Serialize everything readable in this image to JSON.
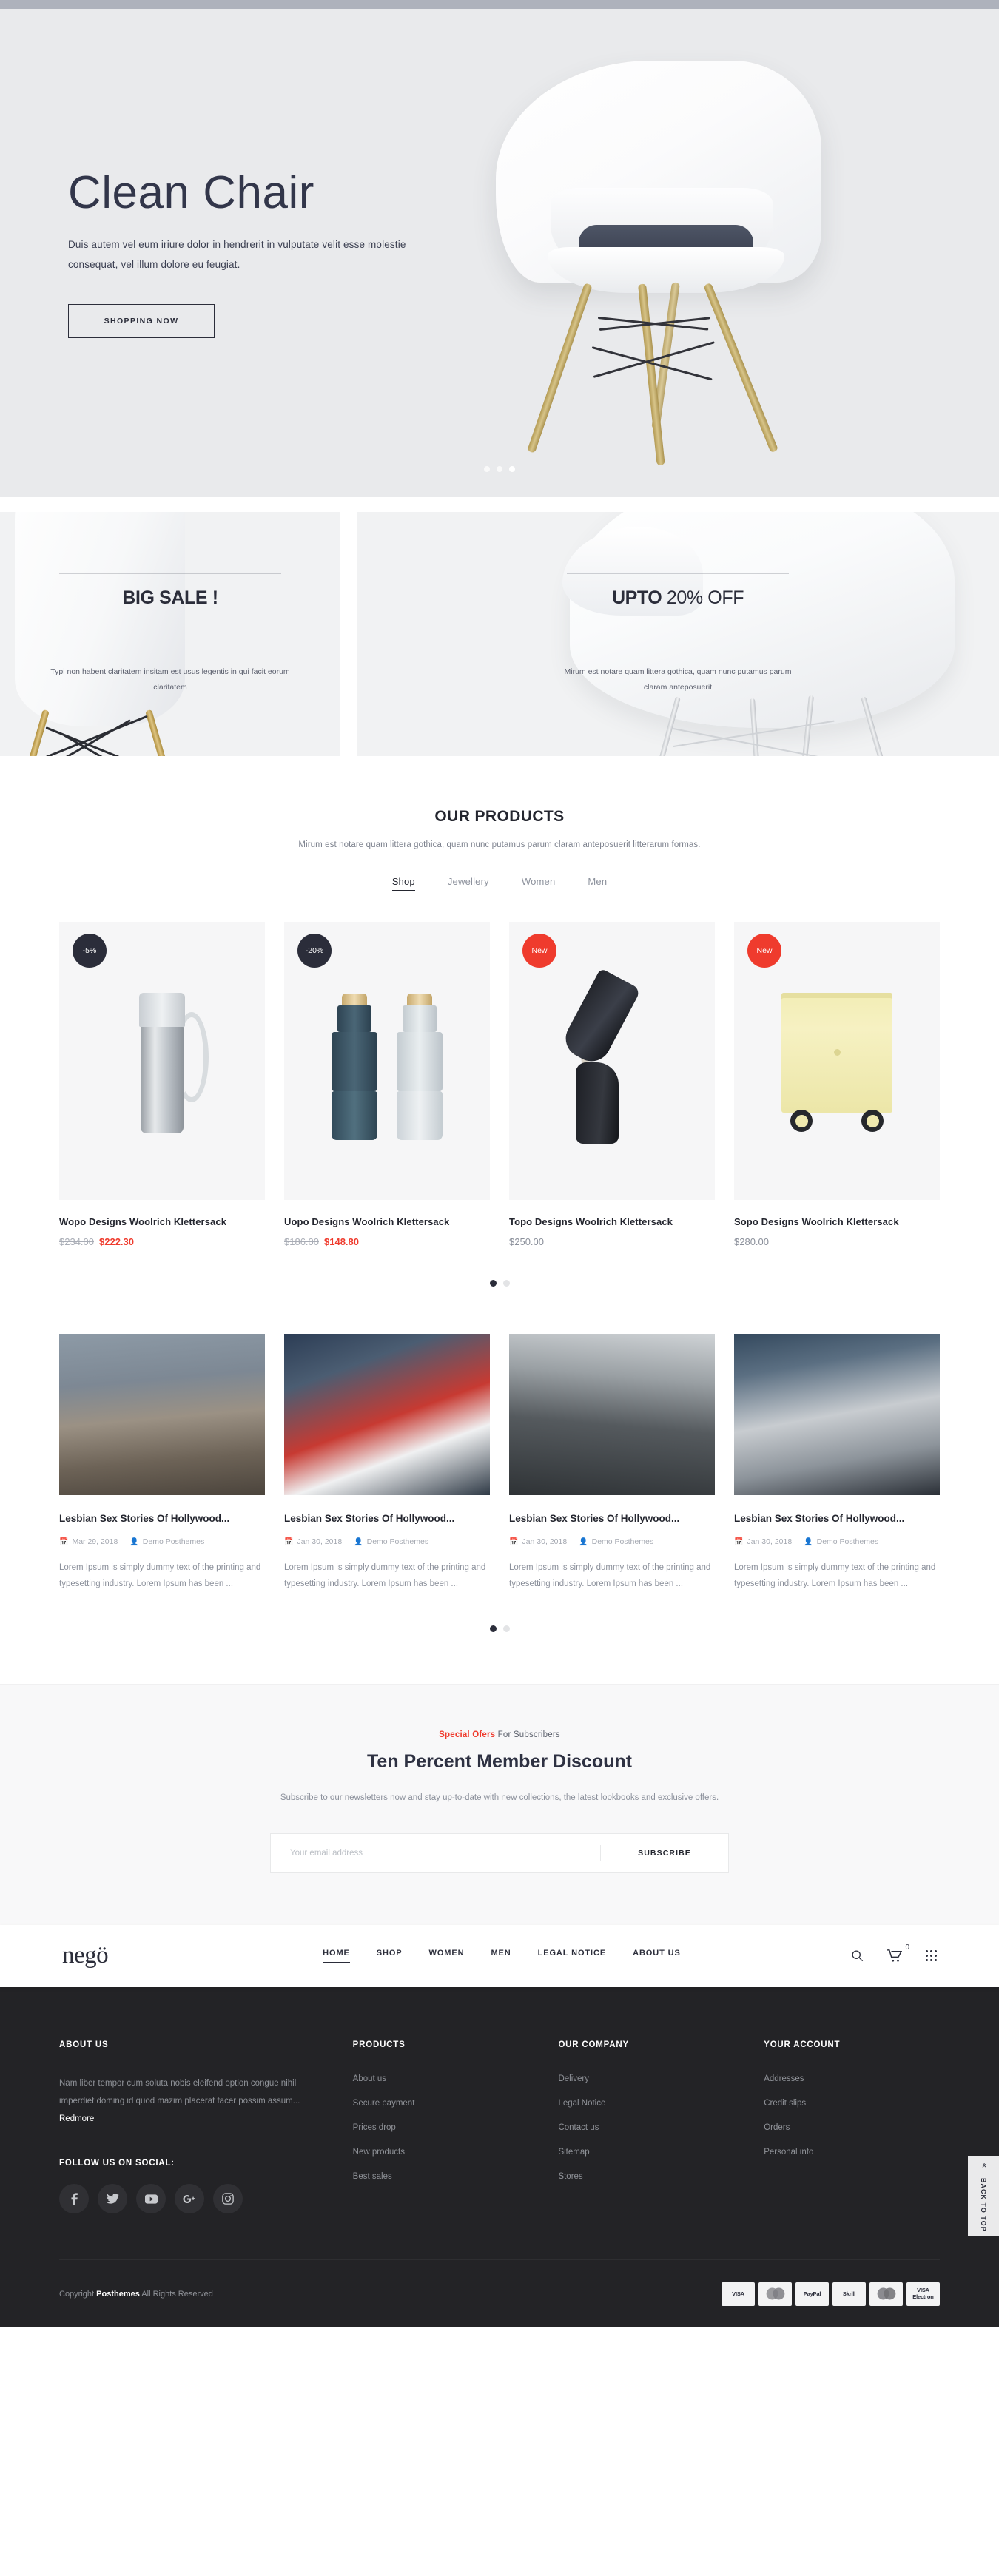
{
  "hero": {
    "title": "Clean Chair",
    "subtitle": "Duis autem vel eum iriure dolor in hendrerit in vulputate velit esse molestie consequat, vel illum dolore eu feugiat.",
    "button": "SHOPPING NOW",
    "slide_count": 3,
    "active_slide": 3
  },
  "promos": [
    {
      "title": "BIG SALE !",
      "desc": "Typi non habent claritatem insitam est usus legentis in qui facit eorum claritatem"
    },
    {
      "title_bold": "UPTO",
      "title_light": "20% OFF",
      "desc": "Mirum est notare quam littera gothica, quam nunc putamus parum claram anteposuerit"
    }
  ],
  "products_section": {
    "title": "OUR PRODUCTS",
    "subtitle": "Mirum est notare quam littera gothica, quam nunc putamus parum claram anteposuerit litterarum formas.",
    "tabs": [
      {
        "label": "Shop",
        "active": true
      },
      {
        "label": "Jewellery",
        "active": false
      },
      {
        "label": "Women",
        "active": false
      },
      {
        "label": "Men",
        "active": false
      }
    ],
    "items": [
      {
        "badge": "-5%",
        "badge_type": "sale",
        "name": "Wopo Designs Woolrich Klettersack",
        "old_price": "$234.00",
        "price": "$222.30",
        "on_sale": true
      },
      {
        "badge": "-20%",
        "badge_type": "sale",
        "name": "Uopo Designs Woolrich Klettersack",
        "old_price": "$186.00",
        "price": "$148.80",
        "on_sale": true
      },
      {
        "badge": "New",
        "badge_type": "new",
        "name": "Topo Designs Woolrich Klettersack",
        "old_price": "",
        "price": "$250.00",
        "on_sale": false
      },
      {
        "badge": "New",
        "badge_type": "new",
        "name": "Sopo Designs Woolrich Klettersack",
        "old_price": "",
        "price": "$280.00",
        "on_sale": false
      }
    ],
    "dots": 2,
    "active_dot": 1
  },
  "blog": {
    "posts": [
      {
        "title": "Lesbian Sex Stories Of Hollywood...",
        "date": "Mar 29, 2018",
        "author": "Demo Posthemes",
        "excerpt": "Lorem Ipsum is simply dummy text of the printing and typesetting industry. Lorem Ipsum has been ..."
      },
      {
        "title": "Lesbian Sex Stories Of Hollywood...",
        "date": "Jan 30, 2018",
        "author": "Demo Posthemes",
        "excerpt": "Lorem Ipsum is simply dummy text of the printing and typesetting industry. Lorem Ipsum has been ..."
      },
      {
        "title": "Lesbian Sex Stories Of Hollywood...",
        "date": "Jan 30, 2018",
        "author": "Demo Posthemes",
        "excerpt": "Lorem Ipsum is simply dummy text of the printing and typesetting industry. Lorem Ipsum has been ..."
      },
      {
        "title": "Lesbian Sex Stories Of Hollywood...",
        "date": "Jan 30, 2018",
        "author": "Demo Posthemes",
        "excerpt": "Lorem Ipsum is simply dummy text of the printing and typesetting industry. Lorem Ipsum has been ..."
      }
    ],
    "dots": 2,
    "active_dot": 1
  },
  "newsletter": {
    "kicker_highlight": "Special Ofers",
    "kicker_rest": " For Subscribers",
    "title": "Ten Percent Member Discount",
    "desc": "Subscribe to our newsletters now and stay up-to-date with new collections, the latest lookbooks and exclusive offers.",
    "placeholder": "Your email address",
    "button": "SUBSCRIBE",
    "value": ""
  },
  "navbar": {
    "logo": "negö",
    "menu": [
      {
        "label": "HOME",
        "active": true
      },
      {
        "label": "SHOP",
        "active": false
      },
      {
        "label": "WOMEN",
        "active": false
      },
      {
        "label": "MEN",
        "active": false
      },
      {
        "label": "LEGAL NOTICE",
        "active": false
      },
      {
        "label": "ABOUT US",
        "active": false
      }
    ],
    "cart_count": "0"
  },
  "footer": {
    "about": {
      "heading": "ABOUT US",
      "text": "Nam liber tempor cum soluta nobis eleifend option congue nihil imperdiet doming id quod mazim placerat facer possim assum...",
      "more": "Redmore",
      "social_heading": "FOLLOW US ON SOCIAL:",
      "socials": [
        "facebook-icon",
        "twitter-icon",
        "youtube-icon",
        "google-plus-icon",
        "instagram-icon"
      ]
    },
    "columns": [
      {
        "heading": "PRODUCTS",
        "links": [
          "About us",
          "Secure payment",
          "Prices drop",
          "New products",
          "Best sales"
        ]
      },
      {
        "heading": "OUR COMPANY",
        "links": [
          "Delivery",
          "Legal Notice",
          "Contact us",
          "Sitemap",
          "Stores"
        ]
      },
      {
        "heading": "YOUR ACCOUNT",
        "links": [
          "Addresses",
          "Credit slips",
          "Orders",
          "Personal info"
        ]
      }
    ],
    "back_to_top": "BACK TO TOP",
    "copyright_pre": "Copyright ",
    "copyright_brand": "Posthemes",
    "copyright_post": " All Rights Reserved",
    "payments": [
      "VISA",
      "MasterCard",
      "PayPal",
      "Skrill",
      "Maestro",
      "VISA Electron"
    ]
  },
  "colors": {
    "accent_red": "#ef3b2d",
    "dark": "#2b2d3a",
    "footer_bg": "#232326",
    "hero_bg": "#e9eaec"
  }
}
